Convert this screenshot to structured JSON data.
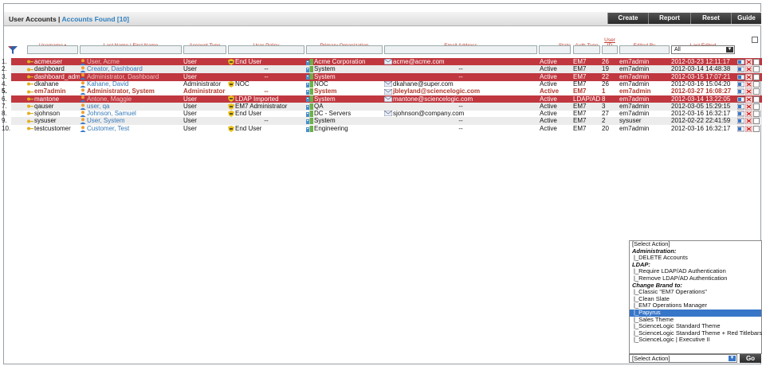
{
  "header": {
    "title": "User Accounts",
    "separator": " | ",
    "found": "Accounts Found [10]",
    "buttons": [
      "Create",
      "Report",
      "Reset",
      "Guide"
    ]
  },
  "columns": {
    "username": "Username •",
    "name": "Last Name | First Name",
    "type": "Account Type",
    "policy": "User Policy",
    "org": "Primary Organization",
    "email": "Email Address",
    "state": "State",
    "auth": "Auth Type",
    "uid": "User ID",
    "edited_by": "Edited By",
    "last_edited": "Last Edited"
  },
  "filters": {
    "last_edited_select": "All"
  },
  "rows": [
    {
      "n": "1.",
      "username": "acmeuser",
      "name": "User, Acme",
      "type": "User",
      "policy": "End User",
      "org": "Acme Corporation",
      "email": "acme@acme.com",
      "state": "Active",
      "auth": "EM7",
      "uid": "26",
      "edited_by": "em7admin",
      "last_edited": "2012-03-23 12:11:17",
      "style": "red"
    },
    {
      "n": "2.",
      "username": "dashboard",
      "name": "Creator, Dashboard",
      "type": "User",
      "policy": "--",
      "org": "System",
      "email": "--",
      "state": "Active",
      "auth": "EM7",
      "uid": "19",
      "edited_by": "em7admin",
      "last_edited": "2012-03-14 14:48:38",
      "style": "alt"
    },
    {
      "n": "3.",
      "username": "dashboard_admin",
      "name": "Administrator, Dashboard",
      "type": "User",
      "policy": "--",
      "org": "System",
      "email": "--",
      "state": "Active",
      "auth": "EM7",
      "uid": "22",
      "edited_by": "em7admin",
      "last_edited": "2012-03-15 17:07:21",
      "style": "red"
    },
    {
      "n": "4.",
      "username": "dkahane",
      "name": "Kahane, David",
      "type": "Administrator",
      "policy": "NOC",
      "org": "NOC",
      "email": "dkahane@super.com",
      "state": "Active",
      "auth": "EM7",
      "uid": "26",
      "edited_by": "em7admin",
      "last_edited": "2012-03-16 15:04:20",
      "style": "plain"
    },
    {
      "n": "5.",
      "username": "em7admin",
      "name": "Administrator, System",
      "type": "Administrator",
      "policy": "--",
      "org": "System",
      "email": "jbleyland@sciencelogic.com",
      "state": "Active",
      "auth": "EM7",
      "uid": "1",
      "edited_by": "em7admin",
      "last_edited": "2012-03-27 16:08:27",
      "style": "me"
    },
    {
      "n": "6.",
      "username": "mantone",
      "name": "Antone, Maggie",
      "type": "User",
      "policy": "LDAP Imported",
      "org": "System",
      "email": "mantone@sciencelogic.com",
      "state": "Active",
      "auth": "LDAP/AD",
      "uid": "8",
      "edited_by": "em7admin",
      "last_edited": "2012-03-14 13:22:05",
      "style": "red"
    },
    {
      "n": "7.",
      "username": "qauser",
      "name": "user, qa",
      "type": "User",
      "policy": "EM7 Administrator",
      "org": "QA",
      "email": "--",
      "state": "Active",
      "auth": "EM7",
      "uid": "3",
      "edited_by": "em7admin",
      "last_edited": "2012-03-05 15:29:15",
      "style": "alt"
    },
    {
      "n": "8.",
      "username": "sjohnson",
      "name": "Johnson, Samuel",
      "type": "User",
      "policy": "End User",
      "org": "DC - Servers",
      "email": "sjohnson@company.com",
      "state": "Active",
      "auth": "EM7",
      "uid": "27",
      "edited_by": "em7admin",
      "last_edited": "2012-03-16 16:32:17",
      "style": "plain"
    },
    {
      "n": "9.",
      "username": "sysuser",
      "name": "User, System",
      "type": "User",
      "policy": "--",
      "org": "System",
      "email": "--",
      "state": "Active",
      "auth": "EM7",
      "uid": "2",
      "edited_by": "sysuser",
      "last_edited": "2012-02-22 22:41:59",
      "style": "alt"
    },
    {
      "n": "10.",
      "username": "testcustomer",
      "name": "Customer, Test",
      "type": "User",
      "policy": "End User",
      "org": "Engineering",
      "email": "--",
      "state": "Active",
      "auth": "EM7",
      "uid": "20",
      "edited_by": "em7admin",
      "last_edited": "2012-03-16 16:32:17",
      "style": "plain"
    }
  ],
  "action_menu": {
    "items": [
      {
        "t": "item",
        "label": "[Select Action]"
      },
      {
        "t": "grp",
        "label": "Administration:"
      },
      {
        "t": "opt",
        "label": "|_DELETE Accounts"
      },
      {
        "t": "grp",
        "label": "LDAP:"
      },
      {
        "t": "opt",
        "label": "|_Require LDAP/AD Authentication"
      },
      {
        "t": "opt",
        "label": "|_Remove LDAP/AD Authentication"
      },
      {
        "t": "grp",
        "label": "Change Brand to:"
      },
      {
        "t": "opt",
        "label": "|_Classic \"EM7 Operations\""
      },
      {
        "t": "opt",
        "label": "|_Clean Slate"
      },
      {
        "t": "opt",
        "label": "|_EM7 Operations Manager"
      },
      {
        "t": "sel",
        "label": "|_Papyrus"
      },
      {
        "t": "opt",
        "label": "|_Sales Theme"
      },
      {
        "t": "opt",
        "label": "|_ScienceLogic Standard Theme"
      },
      {
        "t": "opt",
        "label": "|_ScienceLogic Standard Theme + Red Titlebars"
      },
      {
        "t": "opt",
        "label": "|_ScienceLogic | Executive II"
      }
    ],
    "selected": "[Select Action]",
    "go": "Go"
  },
  "colors": {
    "row_highlight": "#c0373f",
    "link": "#3478b8",
    "selected_option": "#3876c8"
  }
}
